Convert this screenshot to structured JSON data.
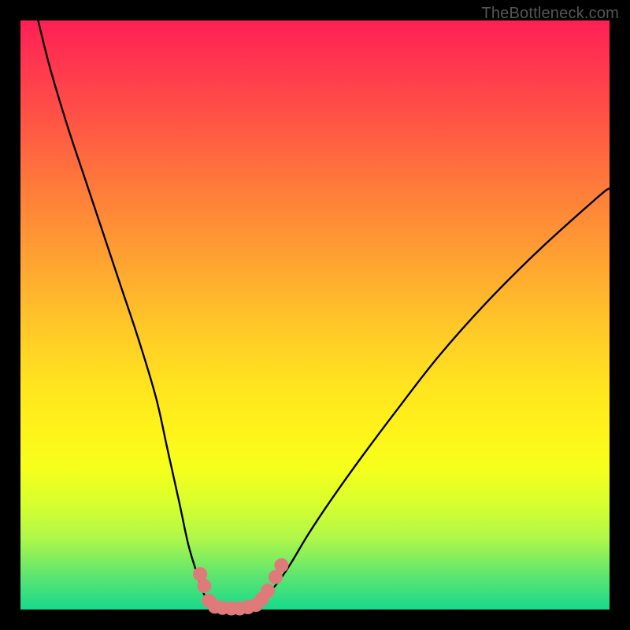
{
  "watermark": "TheBottleneck.com",
  "chart_data": {
    "type": "line",
    "title": "",
    "xlabel": "",
    "ylabel": "",
    "xlim": [
      0,
      100
    ],
    "ylim": [
      0,
      100
    ],
    "grid": false,
    "legend": false,
    "annotations": [],
    "series": [
      {
        "name": "left-branch",
        "x": [
          3,
          5,
          8,
          11,
          14,
          17,
          20,
          23,
          25,
          27,
          28.5,
          30,
          31,
          32,
          33
        ],
        "y": [
          100,
          92,
          82,
          73,
          64,
          55,
          46,
          36,
          27,
          18,
          11,
          6,
          3,
          1,
          0
        ]
      },
      {
        "name": "right-branch",
        "x": [
          40,
          41,
          42,
          44,
          46,
          49,
          53,
          58,
          64,
          71,
          79,
          88,
          98,
          100
        ],
        "y": [
          0,
          1,
          2.5,
          5,
          8,
          13,
          19,
          26,
          34,
          43,
          52,
          61,
          70,
          71.5
        ]
      },
      {
        "name": "floor-segment",
        "x": [
          33,
          40
        ],
        "y": [
          0,
          0
        ]
      }
    ],
    "markers": [
      {
        "name": "left-cluster",
        "color": "#e07a7a",
        "points": [
          {
            "x": 30.5,
            "y": 6
          },
          {
            "x": 31.2,
            "y": 4
          },
          {
            "x": 32.0,
            "y": 1.5
          },
          {
            "x": 33.0,
            "y": 0.5
          },
          {
            "x": 34.3,
            "y": 0.3
          },
          {
            "x": 35.8,
            "y": 0.2
          },
          {
            "x": 37.2,
            "y": 0.2
          },
          {
            "x": 38.6,
            "y": 0.4
          }
        ]
      },
      {
        "name": "right-cluster",
        "color": "#e07a7a",
        "points": [
          {
            "x": 40.0,
            "y": 0.8
          },
          {
            "x": 41.0,
            "y": 1.8
          },
          {
            "x": 42.0,
            "y": 3.2
          },
          {
            "x": 43.3,
            "y": 5.5
          },
          {
            "x": 44.3,
            "y": 7.5
          }
        ]
      }
    ]
  }
}
